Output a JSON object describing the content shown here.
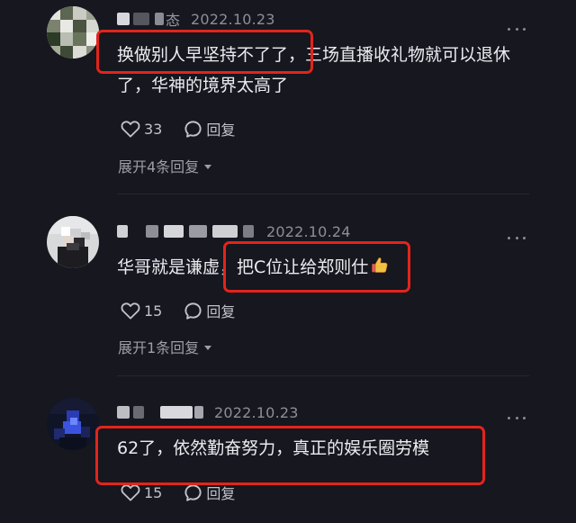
{
  "comments": [
    {
      "name_tail": "态",
      "date": "2022.10.23",
      "text": "换做别人早坚持不了了，三场直播收礼物就可以退休了，华神的境界太高了",
      "likes": "33",
      "reply_label": "回复",
      "expand_label": "展开4条回复"
    },
    {
      "name_tail": "",
      "date": "2022.10.24",
      "text": "华哥就是谦虚，把C位让给郑则仕",
      "likes": "15",
      "reply_label": "回复",
      "expand_label": "展开1条回复"
    },
    {
      "name_tail": "",
      "date": "2022.10.23",
      "text": "62了，依然勤奋努力，真正的娱乐圈劳模",
      "likes": "15",
      "reply_label": "回复"
    }
  ],
  "icons": {
    "like": "heart-outline-icon",
    "reply": "speech-bubble-icon",
    "more": "more-dots-icon",
    "expand": "chevron-down-icon",
    "thumb": "thumbs-up-emoji-icon"
  },
  "colors": {
    "background": "#16171f",
    "highlight": "#e3241b",
    "text": "#ececf0",
    "muted": "#8e8e98"
  }
}
